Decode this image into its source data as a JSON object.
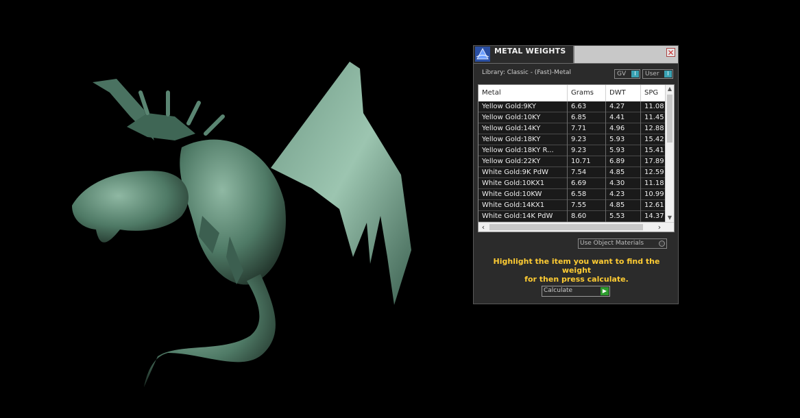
{
  "panel": {
    "title": "METAL WEIGHTS",
    "close_glyph": "✕",
    "logo_icon": "app-logo-icon",
    "library_label": "Library: Classic - (Fast)-Metal",
    "gv_toggle": {
      "label": "GV",
      "knob": "I"
    },
    "user_toggle": {
      "label": "User",
      "knob": "I"
    },
    "table": {
      "columns": [
        "Metal",
        "Grams",
        "DWT",
        "SPG"
      ],
      "rows": [
        [
          "Yellow Gold:9KY",
          "6.63",
          "4.27",
          "11.08"
        ],
        [
          "Yellow Gold:10KY",
          "6.85",
          "4.41",
          "11.45"
        ],
        [
          "Yellow Gold:14KY",
          "7.71",
          "4.96",
          "12.88"
        ],
        [
          "Yellow Gold:18KY",
          "9.23",
          "5.93",
          "15.42"
        ],
        [
          "Yellow Gold:18KY R...",
          "9.23",
          "5.93",
          "15.41"
        ],
        [
          "Yellow Gold:22KY",
          "10.71",
          "6.89",
          "17.89"
        ],
        [
          "White Gold:9K PdW",
          "7.54",
          "4.85",
          "12.59"
        ],
        [
          "White Gold:10KX1",
          "6.69",
          "4.30",
          "11.18"
        ],
        [
          "White Gold:10KW",
          "6.58",
          "4.23",
          "10.99"
        ],
        [
          "White Gold:14KX1",
          "7.55",
          "4.85",
          "12.61"
        ],
        [
          "White Gold:14K PdW",
          "8.60",
          "5.53",
          "14.37"
        ]
      ]
    },
    "use_object_materials": "Use Object Materials",
    "hint_line1": "Highlight the item you want to find the weight",
    "hint_line2": "for then press calculate.",
    "calculate_label": "Calculate",
    "calculate_go": "▶"
  },
  "colors": {
    "background": "#000000",
    "panel": "#2b2b2b",
    "dragon": "#4f7a66",
    "hint": "#ffcc33",
    "toggle_accent": "#3aa3b4",
    "go_button": "#2e9c2e"
  }
}
